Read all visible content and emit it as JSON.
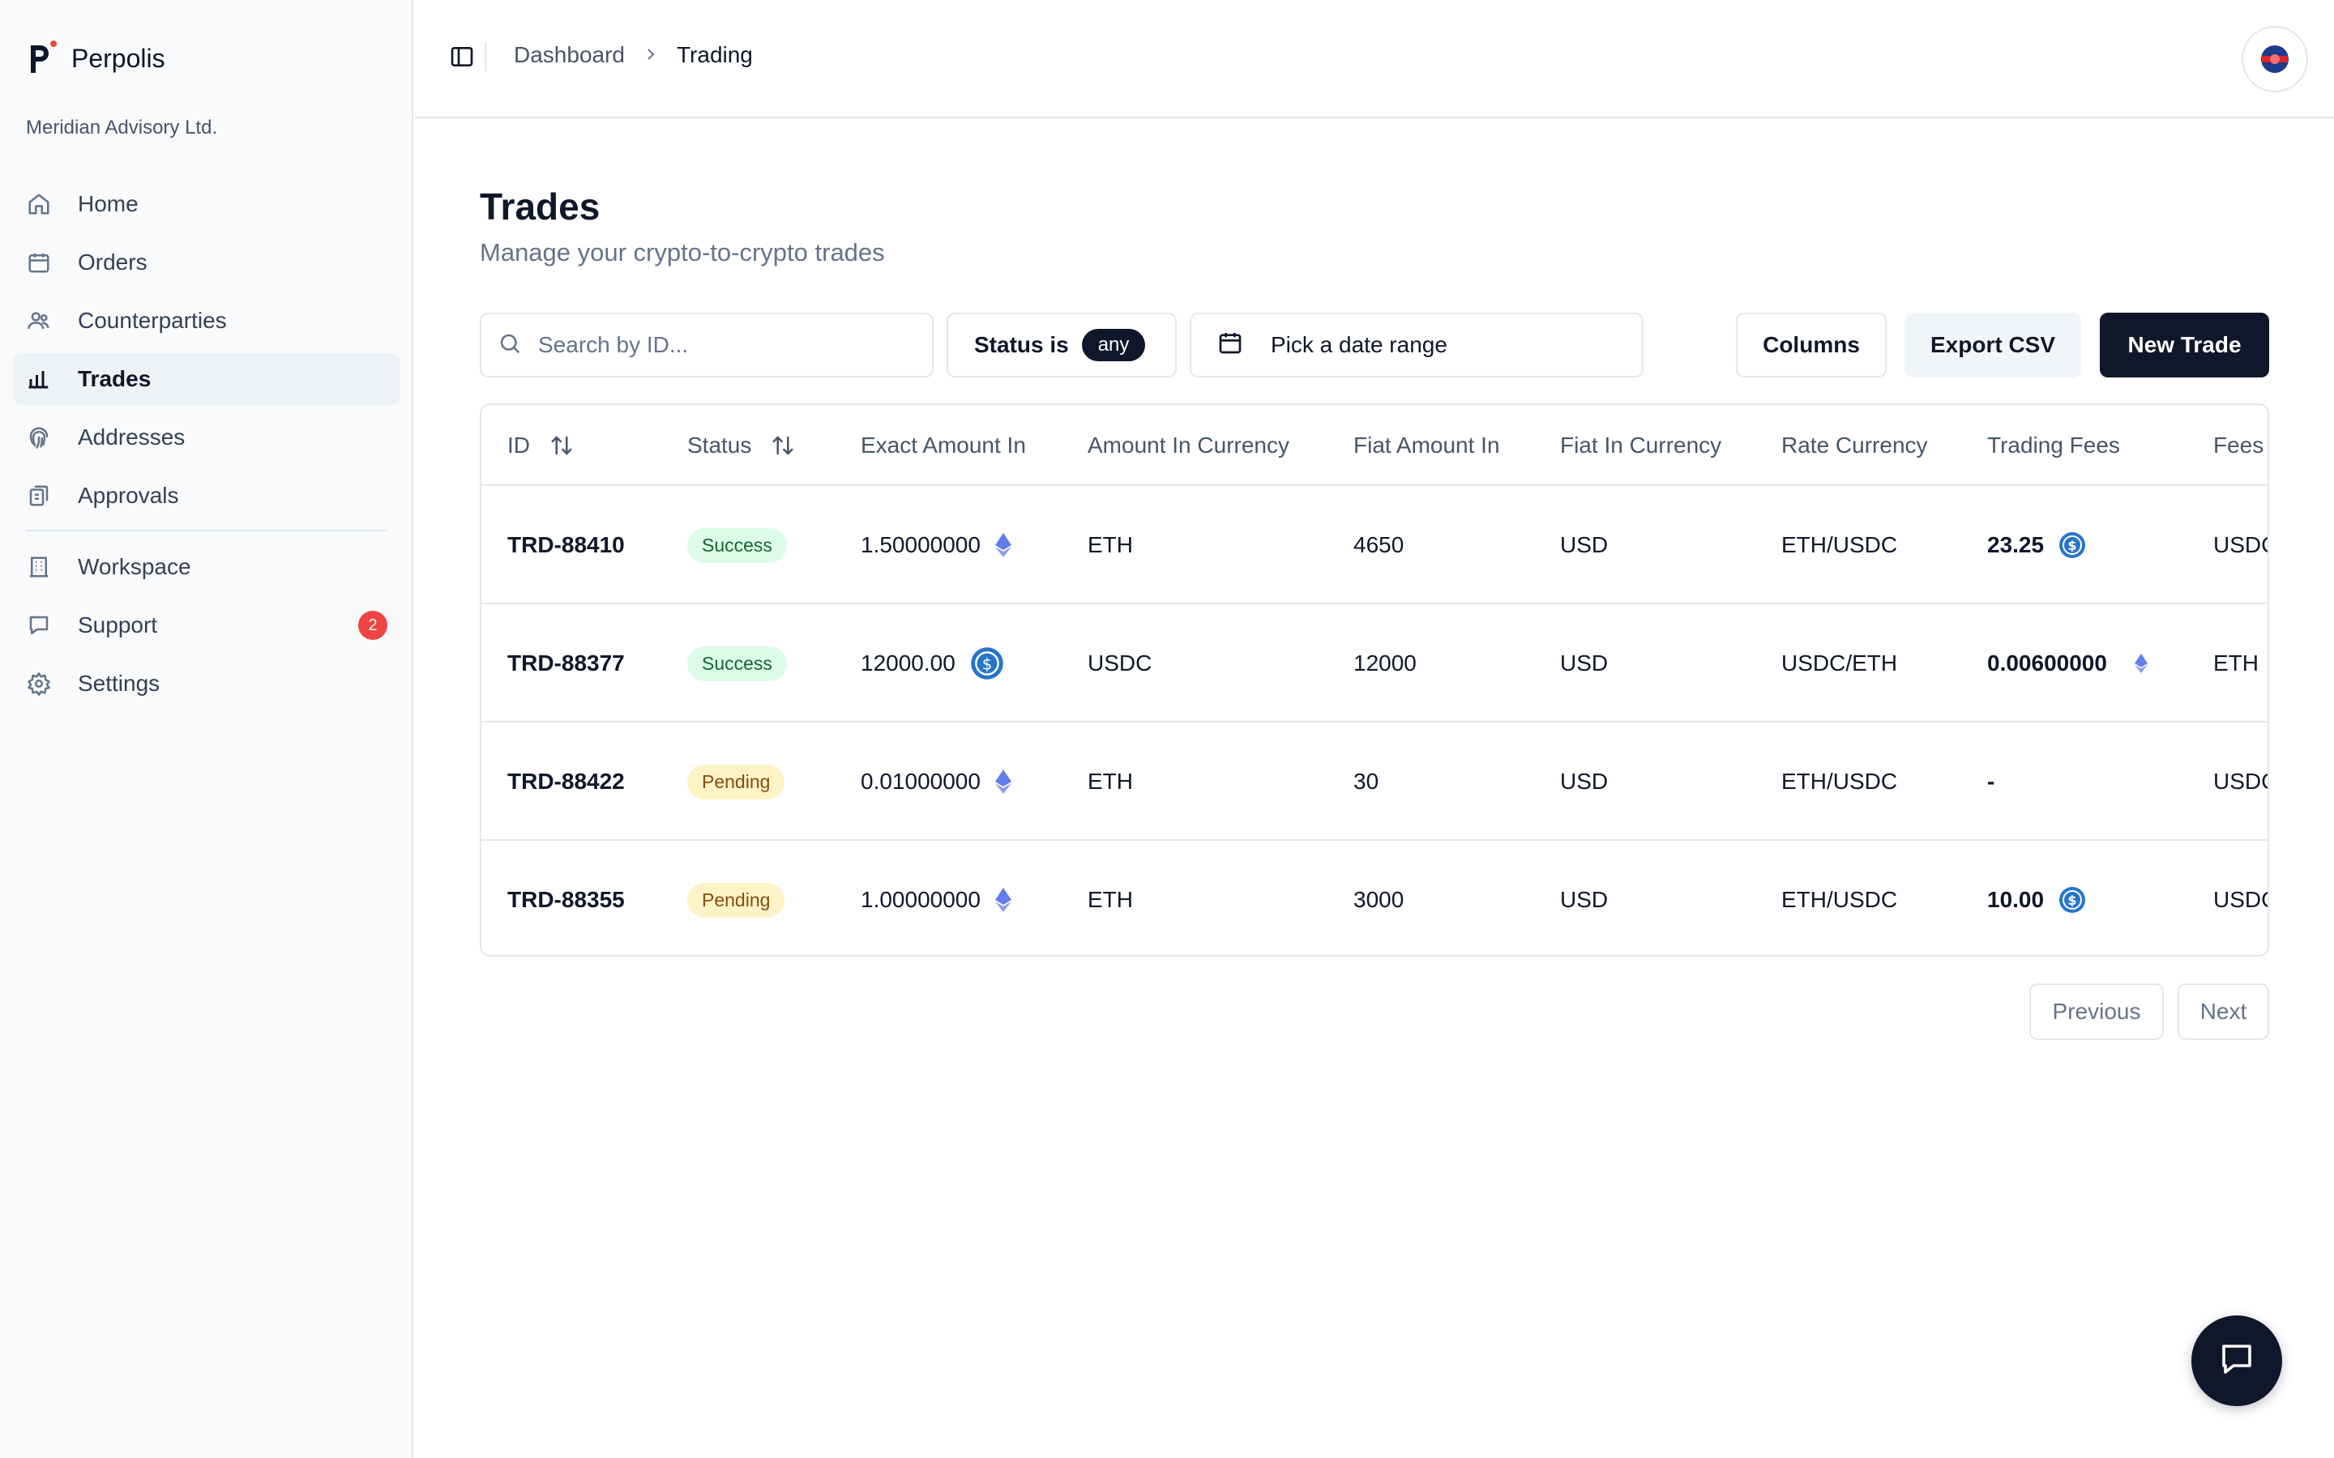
{
  "app": {
    "name": "Perpolis",
    "org": "Meridian Advisory Ltd."
  },
  "sidebar": {
    "items": [
      {
        "label": "Home",
        "icon": "home-icon"
      },
      {
        "label": "Orders",
        "icon": "calendar-icon"
      },
      {
        "label": "Counterparties",
        "icon": "users-icon"
      },
      {
        "label": "Trades",
        "icon": "bar-chart-icon",
        "active": true
      },
      {
        "label": "Addresses",
        "icon": "fingerprint-icon"
      },
      {
        "label": "Approvals",
        "icon": "clipboard-icon"
      },
      {
        "label": "Workspace",
        "icon": "building-icon"
      },
      {
        "label": "Support",
        "icon": "message-icon",
        "badge": "2"
      },
      {
        "label": "Settings",
        "icon": "gear-icon"
      }
    ]
  },
  "header": {
    "breadcrumb": [
      "Dashboard",
      "Trading"
    ]
  },
  "page": {
    "title": "Trades",
    "subtitle": "Manage your crypto-to-crypto trades"
  },
  "toolbar": {
    "search_placeholder": "Search by ID...",
    "status_label": "Status is",
    "status_value": "any",
    "date_placeholder": "Pick a date range",
    "columns_label": "Columns",
    "export_label": "Export CSV",
    "new_label": "New Trade"
  },
  "table": {
    "columns": [
      "ID",
      "Status",
      "Exact Amount In",
      "Amount In Currency",
      "Fiat Amount In",
      "Fiat In Currency",
      "Rate Currency",
      "Trading Fees",
      "Fees"
    ],
    "rows": [
      {
        "id": "TRD-88410",
        "status": "Success",
        "exact_amount_in": "1.50000000",
        "amount_icon": "eth-icon",
        "amount_in_currency": "ETH",
        "fiat_amount_in": "4650",
        "fiat_in_currency": "USD",
        "rate_currency": "ETH/USDC",
        "trading_fees": "23.25",
        "fee_icon": "usdc-icon",
        "fees": "USDC"
      },
      {
        "id": "TRD-88377",
        "status": "Success",
        "exact_amount_in": "12000.00",
        "amount_icon": "usdc-icon",
        "amount_in_currency": "USDC",
        "fiat_amount_in": "12000",
        "fiat_in_currency": "USD",
        "rate_currency": "USDC/ETH",
        "trading_fees": "0.00600000",
        "fee_icon": "eth-icon",
        "fees": "ETH"
      },
      {
        "id": "TRD-88422",
        "status": "Pending",
        "exact_amount_in": "0.01000000",
        "amount_icon": "eth-icon",
        "amount_in_currency": "ETH",
        "fiat_amount_in": "30",
        "fiat_in_currency": "USD",
        "rate_currency": "ETH/USDC",
        "trading_fees": "-",
        "fee_icon": "",
        "fees": "USDC"
      },
      {
        "id": "TRD-88355",
        "status": "Pending",
        "exact_amount_in": "1.00000000",
        "amount_icon": "eth-icon",
        "amount_in_currency": "ETH",
        "fiat_amount_in": "3000",
        "fiat_in_currency": "USD",
        "rate_currency": "ETH/USDC",
        "trading_fees": "10.00",
        "fee_icon": "usdc-icon",
        "fees": "USDC"
      }
    ]
  },
  "pagination": {
    "previous": "Previous",
    "next": "Next"
  },
  "colors": {
    "primary": "#0f172a",
    "success_bg": "#dcfce7",
    "pending_bg": "#fef3c7",
    "badge": "#ef4444",
    "usdc": "#2775ca",
    "eth": "#627eea"
  }
}
